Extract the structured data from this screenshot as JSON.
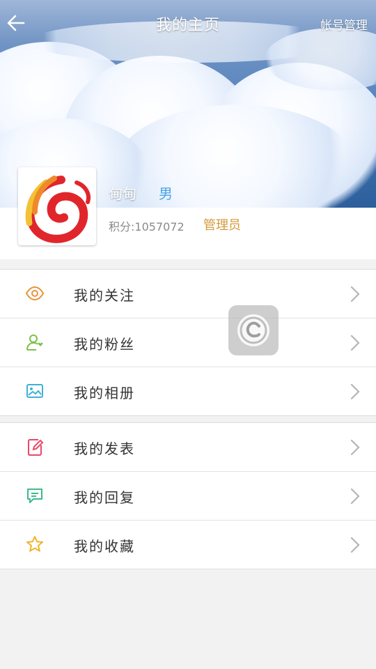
{
  "header": {
    "title": "我的主页",
    "account_link": "帐号管理"
  },
  "profile": {
    "name": "甸甸",
    "gender": "男",
    "points": "积分:1057072",
    "role": "管理员"
  },
  "menu_group_1": [
    {
      "label": "我的关注",
      "icon": "eye-icon",
      "color": "#e8943a"
    },
    {
      "label": "我的粉丝",
      "icon": "user-heart-icon",
      "color": "#7cc04b"
    },
    {
      "label": "我的相册",
      "icon": "image-icon",
      "color": "#3fb0d8"
    }
  ],
  "menu_group_2": [
    {
      "label": "我的发表",
      "icon": "edit-icon",
      "color": "#e8486b"
    },
    {
      "label": "我的回复",
      "icon": "comment-icon",
      "color": "#3fb98a"
    },
    {
      "label": "我的收藏",
      "icon": "star-icon",
      "color": "#f0b429"
    }
  ]
}
